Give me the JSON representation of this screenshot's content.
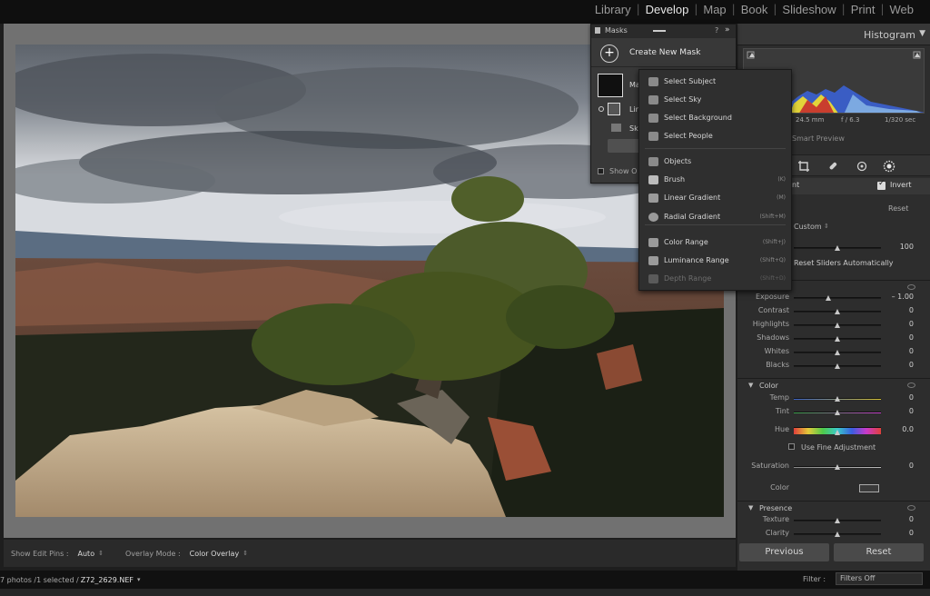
{
  "modules": [
    "Library",
    "Develop",
    "Map",
    "Book",
    "Slideshow",
    "Print",
    "Web"
  ],
  "active_module": "Develop",
  "histogram": {
    "title": "Histogram",
    "info": [
      "24.5 mm",
      "f / 6.3",
      "1/320 sec"
    ],
    "smart_preview": "Smart Preview"
  },
  "masks_panel": {
    "title": "Masks",
    "create": "Create New Mask",
    "row1": "Ma",
    "row2": "Lin",
    "row3": "Sk",
    "show": "Show O"
  },
  "mask_menu": [
    {
      "label": "Select Subject",
      "shortcut": "",
      "disabled": false
    },
    {
      "label": "Select Sky",
      "shortcut": "",
      "disabled": false
    },
    {
      "label": "Select Background",
      "shortcut": "",
      "disabled": false
    },
    {
      "label": "Select People",
      "shortcut": "",
      "disabled": false
    },
    {
      "label": "Objects",
      "shortcut": "",
      "disabled": false
    },
    {
      "label": "Brush",
      "shortcut": "(K)",
      "disabled": false
    },
    {
      "label": "Linear Gradient",
      "shortcut": "(M)",
      "disabled": false
    },
    {
      "label": "Radial Gradient",
      "shortcut": "(Shift+M)",
      "disabled": false
    },
    {
      "label": "Color Range",
      "shortcut": "(Shift+J)",
      "disabled": false
    },
    {
      "label": "Luminance Range",
      "shortcut": "(Shift+Q)",
      "disabled": false
    },
    {
      "label": "Depth Range",
      "shortcut": "(Shift+D)",
      "disabled": true
    }
  ],
  "mask_header": {
    "label": "nt",
    "invert": "Invert",
    "reset": "Reset",
    "preset": "Custom",
    "amount_value": "100",
    "reset_sliders": "Reset Sliders Automatically"
  },
  "light": [
    {
      "label": "Exposure",
      "value": "– 1.00",
      "pos": 0.4
    },
    {
      "label": "Contrast",
      "value": "0",
      "pos": 0.5
    },
    {
      "label": "Highlights",
      "value": "0",
      "pos": 0.5
    },
    {
      "label": "Shadows",
      "value": "0",
      "pos": 0.5
    },
    {
      "label": "Whites",
      "value": "0",
      "pos": 0.5
    },
    {
      "label": "Blacks",
      "value": "0",
      "pos": 0.5
    }
  ],
  "color_section": {
    "title": "Color",
    "temp_label": "Temp",
    "temp_value": "0",
    "tint_label": "Tint",
    "tint_value": "0",
    "hue_label": "Hue",
    "hue_value": "0.0",
    "fine_adjust": "Use Fine Adjustment",
    "saturation_label": "Saturation",
    "saturation_value": "0",
    "color_label": "Color"
  },
  "presence": {
    "title": "Presence",
    "texture_label": "Texture",
    "texture_value": "0",
    "clarity_label": "Clarity",
    "clarity_value": "0"
  },
  "buttons": {
    "previous": "Previous",
    "reset": "Reset"
  },
  "toolbar": {
    "show_edit_pins": "Show Edit Pins :",
    "edit_pins_value": "Auto",
    "overlay_mode": "Overlay Mode :",
    "overlay_value": "Color Overlay"
  },
  "filmstrip": {
    "photos": "7 photos /1 selected /",
    "file": "Z72_2629.NEF",
    "filter_label": "Filter :",
    "filter_value": "Filters Off"
  },
  "colors": {
    "accent": "#dcdcdc",
    "panel": "#2d2d2d",
    "background": "#717171"
  }
}
